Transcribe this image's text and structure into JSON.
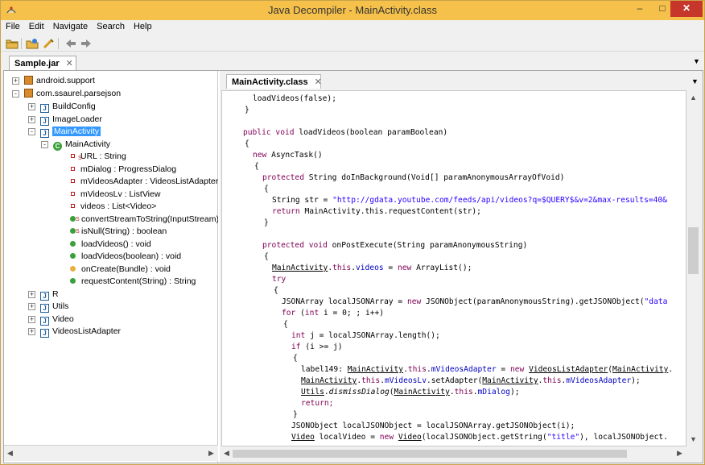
{
  "window": {
    "title": "Java Decompiler - MainActivity.class"
  },
  "menu": [
    "File",
    "Edit",
    "Navigate",
    "Search",
    "Help"
  ],
  "outer_tab": {
    "label": "Sample.jar"
  },
  "inner_tab": {
    "label": "MainActivity.class"
  },
  "tree": [
    {
      "label": "android.support"
    },
    {
      "label": "com.ssaurel.parsejson"
    },
    {
      "label": "BuildConfig"
    },
    {
      "label": "ImageLoader"
    },
    {
      "label": "MainActivity"
    },
    {
      "label": "MainActivity"
    },
    {
      "label": "URL : String"
    },
    {
      "label": "mDialog : ProgressDialog"
    },
    {
      "label": "mVideosAdapter : VideosListAdapter"
    },
    {
      "label": "mVideosLv : ListView"
    },
    {
      "label": "videos : List<Video>"
    },
    {
      "label": "convertStreamToString(InputStream)"
    },
    {
      "label": "isNull(String) : boolean"
    },
    {
      "label": "loadVideos() : void"
    },
    {
      "label": "loadVideos(boolean) : void"
    },
    {
      "label": "onCreate(Bundle) : void"
    },
    {
      "label": "requestContent(String) : String"
    },
    {
      "label": "R"
    },
    {
      "label": "Utils"
    },
    {
      "label": "Video"
    },
    {
      "label": "VideosListAdapter"
    }
  ],
  "code": [
    "loadVideos(false);",
    "}",
    "public void loadVideos(boolean paramBoolean)",
    "{",
    "new AsyncTask()",
    "{",
    "protected String doInBackground(Void[] paramAnonymousArrayOfVoid)",
    "{",
    "String str = \"http://gdata.youtube.com/feeds/api/videos?q=$QUERY$&v=2&max-results=40&",
    "return MainActivity.this.requestContent(str);",
    "}",
    "protected void onPostExecute(String paramAnonymousString)",
    "{",
    "MainActivity.this.videos = new ArrayList();",
    "try",
    "{",
    "JSONArray localJSONArray = new JSONObject(paramAnonymousString).getJSONObject(\"data",
    "for (int i = 0; ; i++)",
    "{",
    "int j = localJSONArray.length();",
    "if (i >= j)",
    "{",
    "label149: MainActivity.this.mVideosAdapter = new VideosListAdapter(MainActivity.",
    "MainActivity.this.mVideosLv.setAdapter(MainActivity.this.mVideosAdapter);",
    "Utils.dismissDialog(MainActivity.this.mDialog);",
    "return;",
    "}",
    "JSONObject localJSONObject = localJSONArray.getJSONObject(i);",
    "Video localVideo = new Video(localJSONObject.getString(\"title\"), localJSONObject."
  ],
  "colors": {
    "titlebar": "#f6c14b",
    "close": "#c7362b",
    "keyword": "#7f0055",
    "string": "#2a00ff",
    "selection": "#3399ff"
  }
}
